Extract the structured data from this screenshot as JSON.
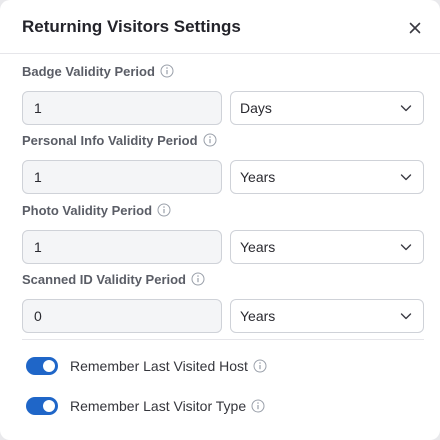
{
  "dialog": {
    "title": "Returning Visitors Settings"
  },
  "fields": [
    {
      "label": "Badge Validity Period",
      "value": "1",
      "unit": "Days"
    },
    {
      "label": "Personal Info Validity Period",
      "value": "1",
      "unit": "Years"
    },
    {
      "label": "Photo Validity Period",
      "value": "1",
      "unit": "Years"
    },
    {
      "label": "Scanned ID Validity Period",
      "value": "0",
      "unit": "Years"
    }
  ],
  "toggles": [
    {
      "label": "Remember Last Visited Host",
      "enabled": true
    },
    {
      "label": "Remember Last Visitor Type",
      "enabled": true
    }
  ],
  "colors": {
    "toggle_on": "#1f66c8",
    "title": "#24242b",
    "label": "#5a5d66"
  },
  "icons": [
    "close-icon",
    "info-icon",
    "chevron-down-icon"
  ]
}
